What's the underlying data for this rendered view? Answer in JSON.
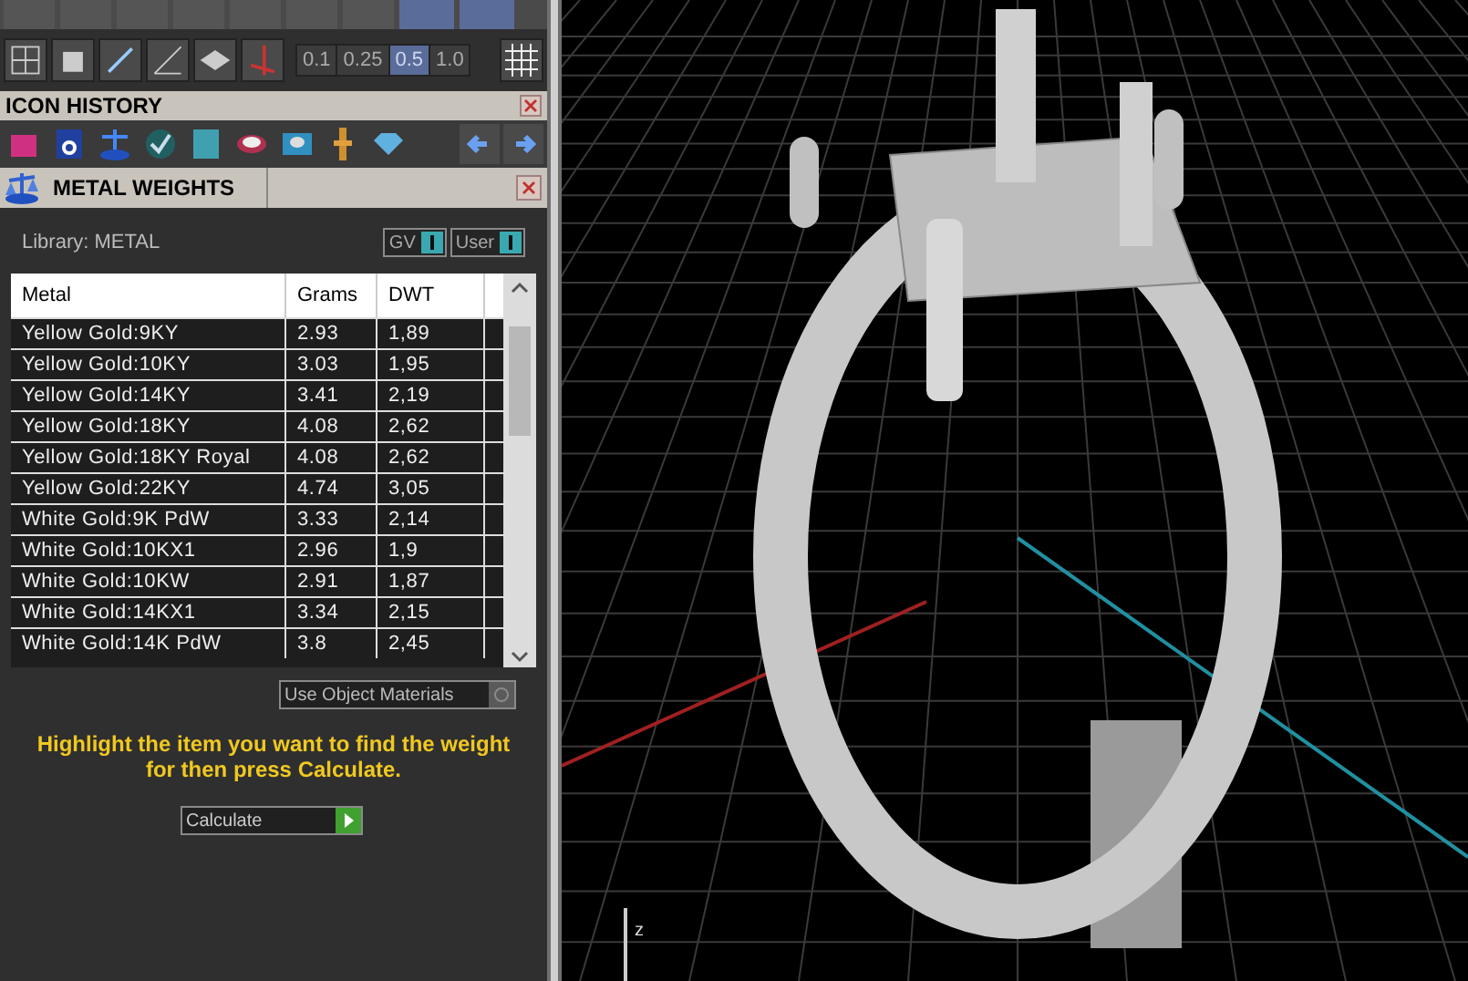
{
  "snap_buttons": [
    {
      "label": "0.1",
      "selected": false
    },
    {
      "label": "0.25",
      "selected": false
    },
    {
      "label": "0.5",
      "selected": true
    },
    {
      "label": "1.0",
      "selected": false
    }
  ],
  "icon_history": {
    "title": "ICON HISTORY"
  },
  "panel": {
    "title": "METAL WEIGHTS",
    "library": "Library: METAL",
    "toggles": [
      {
        "label": "GV",
        "on": true
      },
      {
        "label": "User",
        "on": true
      }
    ],
    "table": {
      "columns": [
        "Metal",
        "Grams",
        "DWT"
      ],
      "rows": [
        [
          "Yellow Gold:9KY",
          "2.93",
          "1,89"
        ],
        [
          "Yellow Gold:10KY",
          "3.03",
          "1,95"
        ],
        [
          "Yellow Gold:14KY",
          "3.41",
          "2,19"
        ],
        [
          "Yellow Gold:18KY",
          "4.08",
          "2,62"
        ],
        [
          "Yellow Gold:18KY Royal",
          "4.08",
          "2,62"
        ],
        [
          "Yellow Gold:22KY",
          "4.74",
          "3,05"
        ],
        [
          "White Gold:9K PdW",
          "3.33",
          "2,14"
        ],
        [
          "White Gold:10KX1",
          "2.96",
          "1,9"
        ],
        [
          "White Gold:10KW",
          "2.91",
          "1,87"
        ],
        [
          "White Gold:14KX1",
          "3.34",
          "2,15"
        ],
        [
          "White Gold:14K PdW",
          "3.8",
          "2,45"
        ]
      ]
    },
    "use_object_materials": {
      "label": "Use Object Materials",
      "checked": false
    },
    "message": "Highlight the item you want to find the weight for then press Calculate.",
    "calculate_button": "Calculate"
  },
  "viewport": {
    "axis_label": "z"
  }
}
